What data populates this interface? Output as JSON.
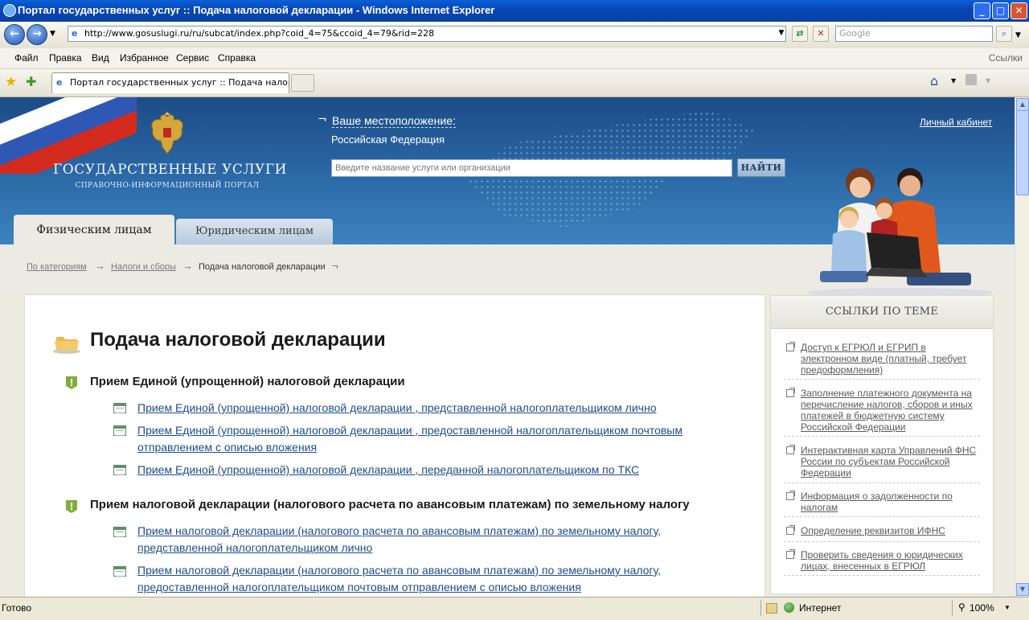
{
  "window": {
    "title": "Портал государственных услуг :: Подача налоговой декларации - Windows Internet Explorer",
    "minimize": "_",
    "maximize": "□",
    "close": "✕"
  },
  "address": {
    "url": "http://www.gosuslugi.ru/ru/subcat/index.php?coid_4=75&ccoid_4=79&rid=228",
    "search_placeholder": "Google"
  },
  "menu": {
    "items": [
      "Файл",
      "Правка",
      "Вид",
      "Избранное",
      "Сервис",
      "Справка"
    ],
    "links_label": "Ссылки"
  },
  "tabs": {
    "active_label": "Портал государственных услуг :: Подача налогов..."
  },
  "header": {
    "logo_title": "ГОСУДАРСТВЕННЫЕ УСЛУГИ",
    "logo_subtitle": "СПРАВОЧНО-ИНФОРМАЦИОННЫЙ ПОРТАЛ",
    "location_label": "Ваше местоположение:",
    "location_value": "Российская Федерация",
    "search_placeholder": "Введите название услуги или организации",
    "search_button": "НАЙТИ",
    "cabinet_link": "Личный кабинет",
    "tab_individuals": "Физическим лицам",
    "tab_legal": "Юридическим лицам"
  },
  "breadcrumb": {
    "items": [
      "По категориям",
      "Налоги и сборы",
      "Подача налоговой декларации"
    ]
  },
  "content": {
    "title": "Подача налоговой декларации",
    "sections": [
      {
        "title": "Прием Единой (упрощенной) налоговой декларации",
        "items": [
          "Прием Единой (упрощенной) налоговой декларации , представленной налогоплательщиком лично",
          "Прием Единой (упрощенной) налоговой декларации , предоставленной налогоплательщиком почтовым отправлением с описью вложения",
          "Прием Единой (упрощенной) налоговой декларации , переданной налогоплательщиком по ТКС"
        ]
      },
      {
        "title": "Прием налоговой декларации (налогового расчета по авансовым платежам) по земельному налогу",
        "items": [
          "Прием налоговой декларации (налогового расчета по авансовым платежам) по земельному налогу, представленной налогоплательщиком лично",
          "Прием налоговой декларации (налогового расчета по авансовым платежам) по земельному налогу, предоставленной налогоплательщиком почтовым отправлением с описью вложения"
        ]
      }
    ]
  },
  "sidebar": {
    "title": "ССЫЛКИ ПО ТЕМЕ",
    "items": [
      "Доступ к ЕГРЮЛ и ЕГРИП в электронном виде (платный, требует предоформления)",
      "Заполнение платежного документа на перечисление налогов, сборов и иных платежей в бюджетную систему Российской Федерации",
      "Интерактивная карта Управлений ФНС России по субъектам Российской Федерации",
      "Информация о задолженности по налогам",
      "Определение реквизитов ИФНС",
      "Проверить сведения о юридических лицах, внесенных в ЕГРЮЛ"
    ]
  },
  "status": {
    "text": "Готово",
    "zone": "Интернет",
    "zoom": "100%"
  }
}
